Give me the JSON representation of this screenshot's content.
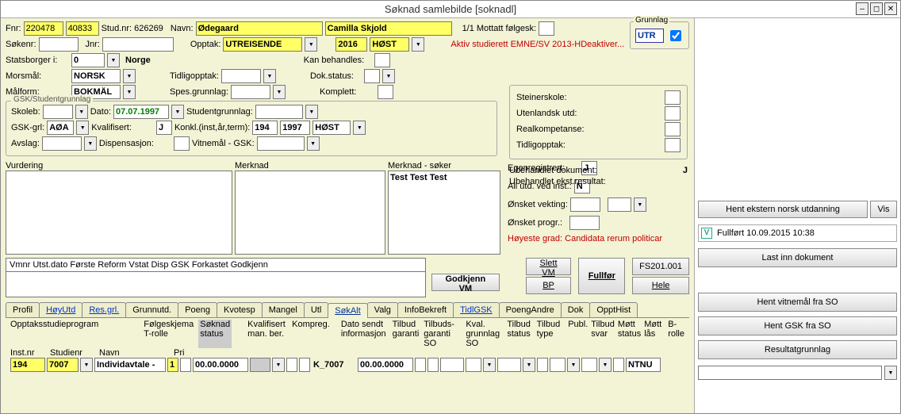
{
  "window": {
    "title": "Søknad samlebilde  [soknadl]"
  },
  "header": {
    "fnr_label": "Fnr:",
    "fnr1": "220478",
    "fnr2": "40833",
    "studnr_label": "Stud.nr:",
    "studnr": "626269",
    "navn_label": "Navn:",
    "etternavn": "Ødegaard",
    "fornavn": "Camilla Skjold",
    "count": "1/1",
    "mottatt_label": "Mottatt følgesk:",
    "sokenr_label": "Søkenr:",
    "jnr_label": "Jnr:",
    "opptak_label": "Opptak:",
    "opptak_type": "UTREISENDE",
    "opptak_ar": "2016",
    "opptak_sem": "HØST"
  },
  "grunnlag": {
    "title": "Grunnlag",
    "value": "UTR"
  },
  "stats": {
    "statsborger_label": "Statsborger i:",
    "statsborger_kode": "0",
    "statsborger_land": "Norge",
    "kanbeh_label": "Kan behandles:",
    "morsmaal_label": "Morsmål:",
    "morsmaal": "NORSK",
    "tidligopptak_label": "Tidligopptak:",
    "dokstatus_label": "Dok.status:",
    "maalform_label": "Målform:",
    "maalform": "BOKMÅL",
    "spesgrunnlag_label": "Spes.grunnlag:",
    "komplett_label": "Komplett:"
  },
  "studierett_text": "Aktiv studierett EMNE/SV 2013-HDeaktiver...",
  "right_checks": {
    "steiner": "Steinerskole:",
    "utenlandsk": "Utenlandsk utd:",
    "realkomp": "Realkompetanse:",
    "tidligopptak": "Tidligopptak:",
    "ubeh_dok_label": "Ubehandlet dokument:",
    "ubeh_dok": "J",
    "ubeh_ekst_label": "Ubehandlet ekst.resultat:"
  },
  "gsk": {
    "title": "GSK/Studentgrunnlag",
    "skoleb_label": "Skoleb:",
    "dato_label": "Dato:",
    "dato": "07.07.1997",
    "studentgrunnlag_label": "Studentgrunnlag:",
    "gskgrl_label": "GSK-grl:",
    "gskgrl": "AØA",
    "kvalifisert_label": "Kvalifisert:",
    "kvalifisert": "J",
    "konkl_label": "Konkl.(inst,år,term):",
    "konkl_inst": "194",
    "konkl_ar": "1997",
    "konkl_term": "HØST",
    "avslag_label": "Avslag:",
    "dispensasjon_label": "Dispensasjon:",
    "vitnemaal_label": "Vitnemål - GSK:"
  },
  "notes": {
    "vurdering_label": "Vurdering",
    "merknad_label": "Merknad",
    "merknad_soker_label": "Merknad - søker",
    "merknad_soker": "Test Test Test"
  },
  "egenreg": {
    "egenreg_label": "Egenregistrert:",
    "egenreg": "J",
    "allutd_label": "All utd. ved inst.:",
    "allutd": "N",
    "onsket_vekt_label": "Ønsket vekting:",
    "onsket_progr_label": "Ønsket progr.:",
    "hoyeste_grad": "Høyeste grad: Candidata rerum politicar"
  },
  "vm": {
    "header": "Vmnr          Utst.dato Første Reform Vstat Disp GSK Forkastet Godkjenn",
    "godkjenn_vm": "Godkjenn VM",
    "slett_vm": "Slett VM",
    "bp": "BP",
    "fullfor": "Fullfør",
    "fs": "FS201.001",
    "hele": "Hele"
  },
  "tabs": [
    "Profil",
    "HøyUtd",
    "Res.grl.",
    "Grunnutd.",
    "Poeng",
    "Kvotesp",
    "Mangel",
    "Utl",
    "SøkAlt",
    "Valg",
    "InfoBekreft",
    "TidlGSK",
    "PoengAndre",
    "Dok",
    "OpptHist"
  ],
  "active_tab": "SøkAlt",
  "grid": {
    "hdr1": "Opptaksstudieprogram",
    "hdr_inst": "Inst.nr",
    "hdr_studienr": "Studienr",
    "hdr_navn": "Navn",
    "hdr_pri": "Pri",
    "hdr_folge": "Følgeskjema T-rolle",
    "hdr_sokstatus": "Søknad status",
    "hdr_kval": "Kvalifisert man. ber.",
    "hdr_kompreg": "Kompreg.",
    "hdr_datosendt": "Dato sendt informasjon",
    "hdr_tilbudg": "Tilbud garanti",
    "hdr_tilbudsg": "Tilbuds-garanti SO",
    "hdr_kvalgrunn": "Kval. grunnlag SO",
    "hdr_tilbudstatus": "Tilbud status",
    "hdr_tilbudtype": "Tilbud type",
    "hdr_publ": "Publ.",
    "hdr_tilbudsvar": "Tilbud svar",
    "hdr_mottstatus": "Møtt status",
    "hdr_mottlas": "Møtt lås",
    "hdr_brolle": "B-rolle",
    "row": {
      "inst": "194",
      "studienr": "7007",
      "navn": "Individavtale -",
      "pri": "1",
      "trolle": "00.00.0000",
      "kompreg": "K_7007",
      "datosendt": "00.00.0000",
      "brolle": "NTNU"
    }
  },
  "rightpanel": {
    "hent_ekstern": "Hent ekstern norsk utdanning",
    "vis": "Vis",
    "fullfort": "Fullført 10.09.2015 10:38",
    "last_inn": "Last inn dokument",
    "hent_vitnemal": "Hent vitnemål fra SO",
    "hent_gsk": "Hent GSK fra SO",
    "resultat": "Resultatgrunnlag"
  }
}
